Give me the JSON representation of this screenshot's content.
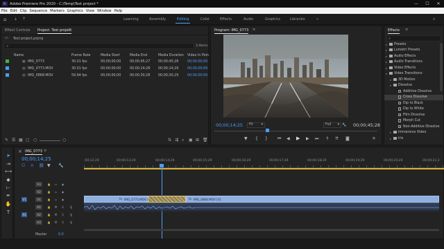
{
  "titlebar": {
    "title": "Adobe Premiere Pro 2020 - C:\\Temp\\Test project *",
    "logo": "Pr",
    "min": "—",
    "max": "☐",
    "close": "✕"
  },
  "menu": [
    "File",
    "Edit",
    "Clip",
    "Sequence",
    "Markers",
    "Graphics",
    "View",
    "Window",
    "Help"
  ],
  "workspaces": [
    "Learning",
    "Assembly",
    "Editing",
    "Color",
    "Effects",
    "Audio",
    "Graphics",
    "Libraries"
  ],
  "workspace_more": "»",
  "project_panel": {
    "tabs": [
      "Effect Controls",
      "Project: Test project"
    ],
    "file": "Test project.prproj",
    "item_count": "3 Items",
    "columns": [
      "Name",
      "Frame Rate",
      "Media Start",
      "Media End",
      "Media Duration",
      "Video In Poin"
    ],
    "rows": [
      {
        "name": "IMG_0773",
        "frame_rate": "30.01 fps",
        "media_start": "00;00;00;00",
        "media_end": "00;00;45;27",
        "media_duration": "00;00;45;28",
        "video_in": "00;00;00;00",
        "color": "#3fb24a",
        "type": "sequence"
      },
      {
        "name": "IMG_0773.MOV",
        "frame_rate": "30.01 fps",
        "media_start": "00;00;00;00",
        "media_end": "00;00;14;28",
        "media_duration": "00;00;14;29",
        "video_in": "00;00;00;00",
        "color": "#4a9eff",
        "type": "clip"
      },
      {
        "name": "IMG_0868.MOV",
        "frame_rate": "59.94 fps",
        "media_start": "00;00;00;00",
        "media_end": "00;00;30;28",
        "media_duration": "00;00;30;29",
        "video_in": "00;00;00;00",
        "color": "#4a9eff",
        "type": "clip"
      }
    ]
  },
  "program_monitor": {
    "title": "Program: IMG_0773",
    "timecode": "00;00;14;25",
    "fit": "Fit",
    "quality": "Full",
    "duration": "00;00;45;28"
  },
  "effects_panel": {
    "title": "Effects",
    "items": [
      {
        "label": "Presets",
        "kind": "folder",
        "level": 0
      },
      {
        "label": "Lumetri Presets",
        "kind": "folder",
        "level": 0
      },
      {
        "label": "Audio Effects",
        "kind": "folder",
        "level": 0
      },
      {
        "label": "Audio Transitions",
        "kind": "folder",
        "level": 0
      },
      {
        "label": "Video Effects",
        "kind": "folder",
        "level": 0
      },
      {
        "label": "Video Transitions",
        "kind": "folder",
        "level": 0,
        "open": true
      },
      {
        "label": "3D Motion",
        "kind": "folder",
        "level": 1
      },
      {
        "label": "Dissolve",
        "kind": "folder",
        "level": 1,
        "open": true
      },
      {
        "label": "Additive Dissolve",
        "kind": "effect",
        "level": 2
      },
      {
        "label": "Cross Dissolve",
        "kind": "effect",
        "level": 2,
        "selected": true
      },
      {
        "label": "Dip to Black",
        "kind": "effect",
        "level": 2
      },
      {
        "label": "Dip to White",
        "kind": "effect",
        "level": 2
      },
      {
        "label": "Film Dissolve",
        "kind": "effect",
        "level": 2
      },
      {
        "label": "Morph Cut",
        "kind": "effect",
        "level": 2
      },
      {
        "label": "Non-Additive Dissolve",
        "kind": "effect",
        "level": 2
      },
      {
        "label": "Immersive Video",
        "kind": "folder",
        "level": 1
      },
      {
        "label": "Iris",
        "kind": "folder",
        "level": 1
      }
    ]
  },
  "timeline": {
    "sequence_name": "IMG_0773",
    "timecode": "00;00;14;25",
    "ruler": [
      ";00;12;29",
      "00;00;13;29",
      "00;00;14;29",
      "00;00;15;29",
      "00;00;16;29",
      "00;00;17;29",
      "00;00;18;29",
      "00;00;19;29",
      "00;00;20;29",
      "00;00;21;2"
    ],
    "video_tracks": [
      "V3",
      "V2",
      "V1"
    ],
    "audio_tracks": [
      "A1",
      "A2",
      "A3"
    ],
    "master_label": "Master",
    "master_value": "0.0",
    "clips": [
      {
        "label": "IMG_0773.MOV [V]",
        "track": "V1"
      },
      {
        "label": "IMG_0868.MOV [V]",
        "track": "V1"
      }
    ],
    "playhead_fraction": 0.19
  }
}
